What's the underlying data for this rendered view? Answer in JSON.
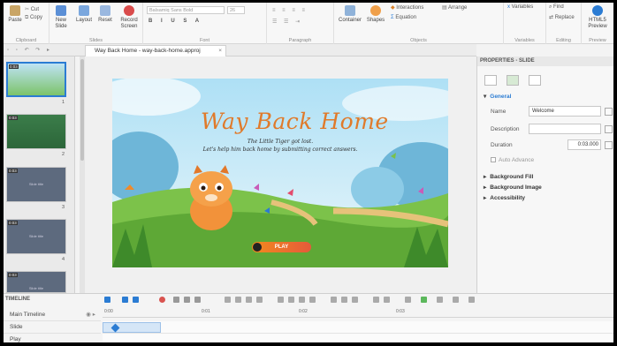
{
  "ribbon": {
    "groups": {
      "clipboard": "Clipboard",
      "slides": "Slides",
      "font": "Font",
      "paragraph": "Paragraph",
      "objects": "Objects",
      "variables": "Variables",
      "editing": "Editing",
      "preview": "Preview"
    },
    "buttons": {
      "paste": "Paste",
      "new_slide": "New Slide",
      "layout": "Layout",
      "reset": "Reset",
      "record_screen": "Record Screen",
      "container": "Container",
      "shapes": "Shapes",
      "html5_preview": "HTML5 Preview",
      "variables": "Variables",
      "find": "Find",
      "replace": "Replace",
      "interactions": "Interactions",
      "arrange": "Arrange",
      "equation": "Equation",
      "cut": "Cut",
      "copy": "Copy"
    },
    "font_name": "Balsamiq Sans Bold",
    "font_size": "26"
  },
  "document": {
    "tab_title": "Way Back Home - way-back-home.approj",
    "close": "×"
  },
  "filmstrip": {
    "slides": [
      {
        "number": "1",
        "badge": "0:03",
        "label": ""
      },
      {
        "number": "2",
        "badge": "0:03",
        "label": ""
      },
      {
        "number": "3",
        "badge": "0:03",
        "label": "Slide title"
      },
      {
        "number": "4",
        "badge": "0:03",
        "label": "Slide title"
      },
      {
        "number": "5",
        "badge": "0:03",
        "label": "Slide title"
      }
    ]
  },
  "slide": {
    "title": "Way Back Home",
    "subtitle_line1": "The Little Tiger got lost.",
    "subtitle_line2": "Let's help him back home by submitting correct answers.",
    "play_label": "PLAY"
  },
  "properties": {
    "header": "PROPERTIES - SLIDE",
    "general": "General",
    "name_label": "Name",
    "name_value": "Welcome",
    "description_label": "Description",
    "description_value": "",
    "duration_label": "Duration",
    "duration_value": "0:03.000",
    "auto_advance": "Auto Advance",
    "background_fill": "Background Fill",
    "background_image": "Background Image",
    "accessibility": "Accessibility"
  },
  "timeline": {
    "title": "TIMELINE",
    "main_timeline": "Main Timeline",
    "rows": [
      "Slide",
      "Play"
    ],
    "ticks": [
      "0:00",
      "0:01",
      "0:02",
      "0:03"
    ]
  },
  "colors": {
    "accent": "#2b7cd3",
    "title_orange": "#e07a2a",
    "play_gradient_start": "#f28a1e"
  }
}
